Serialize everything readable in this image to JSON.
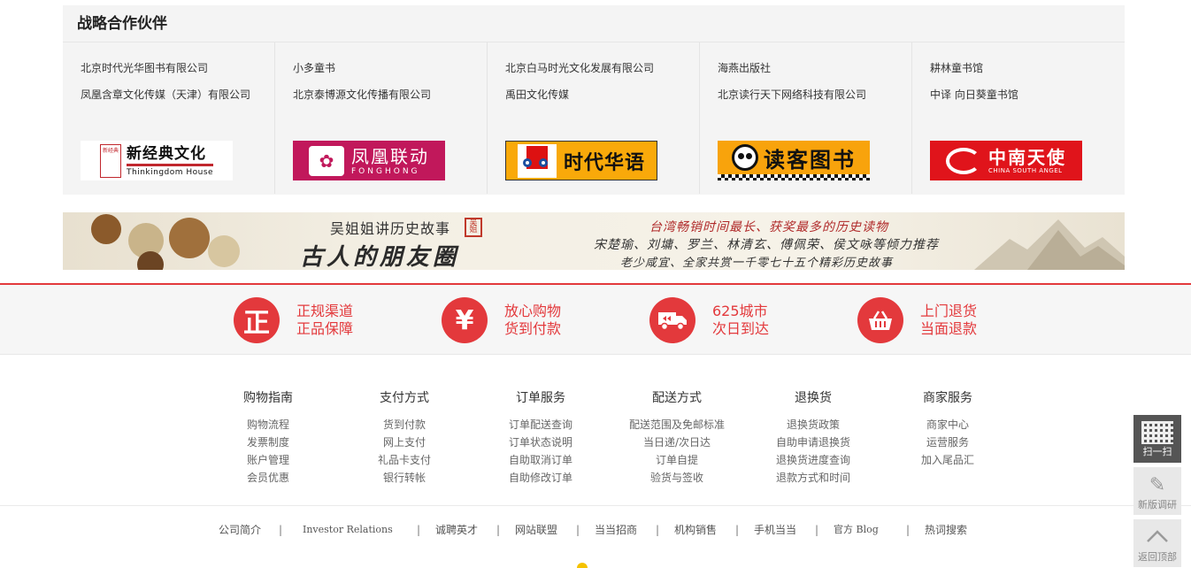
{
  "partners": {
    "title": "战略合作伙伴",
    "columns": [
      {
        "links": [
          "北京时代光华图书有限公司",
          "凤凰含章文化传媒（天津）有限公司"
        ],
        "logo": {
          "main": "新经典文化",
          "sub": "Thinkingdom House",
          "seal": "新经典"
        }
      },
      {
        "links": [
          "小多童书",
          "北京泰博源文化传播有限公司"
        ],
        "logo": {
          "main": "凤凰联动",
          "sub": "FONGHONG"
        }
      },
      {
        "links": [
          "北京白马时光文化发展有限公司",
          "禹田文化传媒"
        ],
        "logo": {
          "main": "时代华语"
        }
      },
      {
        "links": [
          "海燕出版社",
          "北京读行天下网络科技有限公司"
        ],
        "logo": {
          "main": "读客图书"
        }
      },
      {
        "links": [
          "耕林童书馆",
          "中译 向日葵童书馆"
        ],
        "logo": {
          "main": "中南天使",
          "sub": "CHINA SOUTH ANGEL"
        }
      }
    ]
  },
  "banner": {
    "title": "吴姐姐讲历史故事",
    "headline": "古人的朋友圈",
    "seal": "吴姐",
    "line1": "台湾畅销时间最长、获奖最多的历史读物",
    "line2": "宋楚瑜、刘墉、罗兰、林清玄、傅佩荣、侯文咏等倾力推荐",
    "line3": "老少咸宜、全家共赏一千零七十五个精彩历史故事"
  },
  "guarantees": [
    {
      "icon": "正",
      "line1": "正规渠道",
      "line2": "正品保障"
    },
    {
      "icon": "¥",
      "line1": "放心购物",
      "line2": "货到付款"
    },
    {
      "icon": "truck",
      "line1": "625城市",
      "line2": "次日到达"
    },
    {
      "icon": "basket",
      "line1": "上门退货",
      "line2": "当面退款"
    }
  ],
  "footer_nav": [
    {
      "title": "购物指南",
      "links": [
        "购物流程",
        "发票制度",
        "账户管理",
        "会员优惠"
      ]
    },
    {
      "title": "支付方式",
      "links": [
        "货到付款",
        "网上支付",
        "礼品卡支付",
        "银行转帐"
      ]
    },
    {
      "title": "订单服务",
      "links": [
        "订单配送查询",
        "订单状态说明",
        "自助取消订单",
        "自助修改订单"
      ]
    },
    {
      "title": "配送方式",
      "links": [
        "配送范围及免邮标准",
        "当日递/次日达",
        "订单自提",
        "验货与签收"
      ]
    },
    {
      "title": "退换货",
      "links": [
        "退换货政策",
        "自助申请退换货",
        "退换货进度查询",
        "退款方式和时间"
      ]
    },
    {
      "title": "商家服务",
      "links": [
        "商家中心",
        "运营服务",
        "加入尾品汇"
      ]
    }
  ],
  "bottom_links": [
    "公司简介",
    "Investor Relations",
    "诚聘英才",
    "网站联盟",
    "当当招商",
    "机构销售",
    "手机当当",
    "官方 Blog",
    "热词搜索"
  ],
  "separator": "|",
  "side_tools": {
    "scan": "扫一扫",
    "survey": "新版调研",
    "top": "返回顶部"
  },
  "colors": {
    "accent": "#e3393c",
    "partner_bg": "#f4f4f4"
  }
}
